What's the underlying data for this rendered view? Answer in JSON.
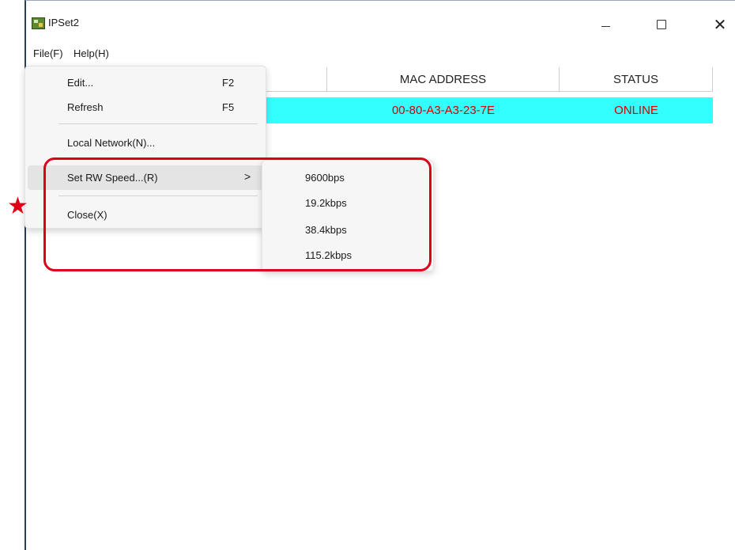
{
  "window": {
    "title": "IPSet2",
    "icons": {
      "app": "app-icon",
      "minimize": "minimize-icon",
      "maximize": "maximize-icon",
      "close": "close-icon"
    },
    "close_glyph": "✕"
  },
  "menubar": {
    "file": "File(F)",
    "help": "Help(H)"
  },
  "table": {
    "headers": [
      "",
      "MAC ADDRESS",
      "STATUS"
    ],
    "rows": [
      {
        "mac": "00-80-A3-A3-23-7E",
        "status": "ONLINE"
      }
    ],
    "row_color": "#33ffff",
    "text_color": "#d10000"
  },
  "file_menu": {
    "items": [
      {
        "label": "Edit...",
        "shortcut": "F2"
      },
      {
        "label": "Refresh",
        "shortcut": "F5"
      },
      {
        "label": "Local Network(N)..."
      },
      {
        "label": "Set RW Speed...(R)",
        "arrow": ">"
      },
      {
        "label": "Close(X)"
      }
    ]
  },
  "rw_speed_submenu": {
    "items": [
      "9600bps",
      "19.2kbps",
      "38.4kbps",
      "115.2kbps"
    ]
  },
  "annotation": {
    "star": "★",
    "color": "#e0001a"
  }
}
